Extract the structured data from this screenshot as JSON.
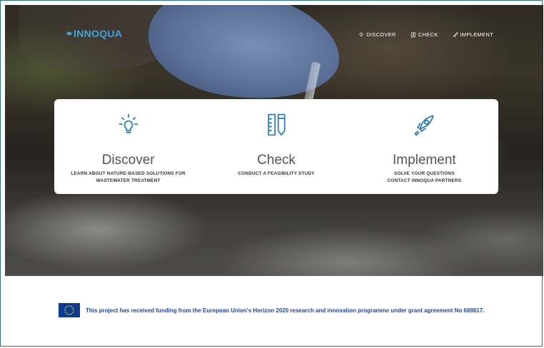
{
  "brand": {
    "name": "INNOQUA",
    "color": "#3aa5dd"
  },
  "nav": {
    "items": [
      {
        "label": "DISCOVER",
        "icon": "lightbulb-icon"
      },
      {
        "label": "CHECK",
        "icon": "test-tubes-icon"
      },
      {
        "label": "IMPLEMENT",
        "icon": "rocket-icon"
      }
    ]
  },
  "cards": [
    {
      "title": "Discover",
      "subtitle_lines": [
        "LEARN ABOUT NATURE-BASED SOLUTIONS FOR",
        "WASTEWATER TREATMENT"
      ],
      "icon": "lightbulb-icon"
    },
    {
      "title": "Check",
      "subtitle_lines": [
        "CONDUCT A FEASIBILITY STUDY"
      ],
      "icon": "ruler-pencil-icon"
    },
    {
      "title": "Implement",
      "subtitle_lines": [
        "SOLVE YOUR QUESTIONS",
        "CONTACT INNOQUA PARTNERS"
      ],
      "icon": "rocket-icon"
    }
  ],
  "footer": {
    "funding_text": "This project has received funding from the European Union's Horizon 2020 research and innovation programme under grant agreement No 689817.",
    "flag_icon": "eu-flag-icon"
  },
  "colors": {
    "accent": "#2b7dc0",
    "text_dark": "#333333",
    "footer_text": "#1c4aa3"
  }
}
